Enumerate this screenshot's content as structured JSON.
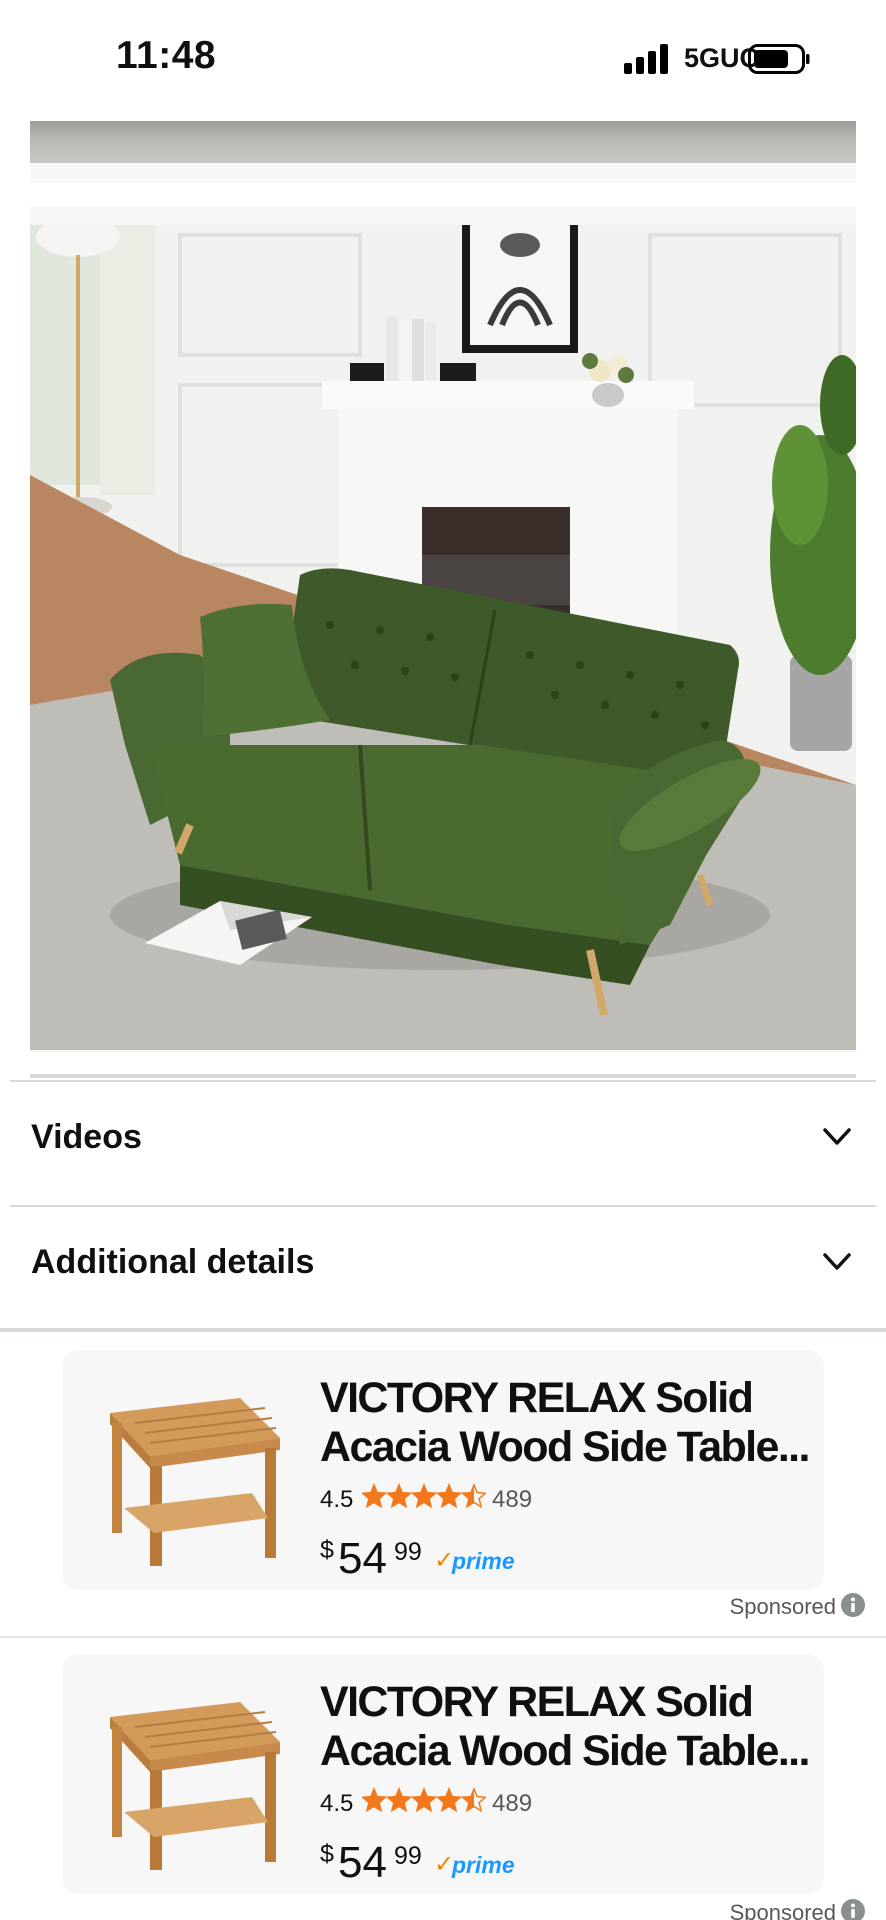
{
  "status_bar": {
    "time": "11:48",
    "network": "5GUC",
    "icons": [
      "signal-icon",
      "battery-icon"
    ]
  },
  "gallery": {
    "image_description_icon": "green-tufted-sofa-image"
  },
  "accordion": [
    {
      "label": "Videos",
      "icon": "chevron-down-icon"
    },
    {
      "label": "Additional details",
      "icon": "chevron-down-icon"
    }
  ],
  "sponsored_products": [
    {
      "title": "VICTORY RELAX Solid Acacia Wood Side Table...",
      "rating": "4.5",
      "stars": 4.5,
      "reviews": "489",
      "price_currency": "$",
      "price_whole": "54",
      "price_fraction": "99",
      "prime_label": "prime",
      "sponsored_label": "Sponsored"
    },
    {
      "title": "VICTORY RELAX Solid Acacia Wood Side Table...",
      "rating": "4.5",
      "stars": 4.5,
      "reviews": "489",
      "price_currency": "$",
      "price_whole": "54",
      "price_fraction": "99",
      "prime_label": "prime",
      "sponsored_label": "Sponsored"
    }
  ],
  "colors": {
    "star": "#f2781b",
    "prime_blue": "#1a98ff",
    "prime_check": "#f08804",
    "sofa_green": "#3f5a2a"
  }
}
